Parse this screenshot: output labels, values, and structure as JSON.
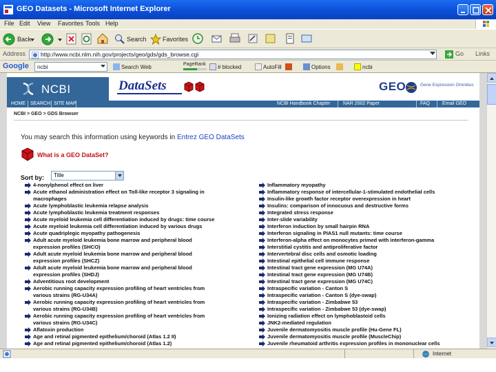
{
  "window": {
    "title": "GEO Datasets - Microsoft Internet Explorer",
    "accent": "#0a4fd8"
  },
  "menu": [
    "File",
    "Edit",
    "View",
    "Favorites",
    "Tools",
    "Help"
  ],
  "toolbar": {
    "back": "Back",
    "search": "Search",
    "favorites": "Favorites"
  },
  "address": {
    "label": "Address",
    "url": "http://www.ncbi.nlm.nih.gov/projects/geo/gds/gds_browse.cgi",
    "go": "Go",
    "links": "Links"
  },
  "google": {
    "logo": "Google",
    "query": "ncbi",
    "search_web": "Search Web",
    "pagerank": "PageRank",
    "blocked": "# blocked",
    "autofill": "AutoFill",
    "options": "Options",
    "highlight": "ncbi"
  },
  "site": {
    "ncbi": "NCBI",
    "datasets_logo": "DataSets",
    "geo": "GEO",
    "geo_tagline": "Gene Expression Omnibus",
    "nav": [
      "HOME",
      "SEARCH",
      "SITE MAP"
    ],
    "nav_right": [
      "NCBI Handbook Chapter",
      "NAR 2002 Paper",
      "FAQ",
      "Email GEO"
    ],
    "breadcrumb": "NCBI > GEO > GDS Browser",
    "intro_prefix": "You may search this information using keywords in ",
    "intro_link": "Entrez GEO DataSets",
    "what_link": "What is a GEO DataSet?",
    "sort_label": "Sort by:",
    "sort_value": "Title",
    "brand_color": "#336699"
  },
  "datasets_left": [
    [
      "4-nonylphenol effect on liver",
      ""
    ],
    [
      "Acute ethanol administration effect on Toll-like receptor 3 signaling in",
      "macrophages"
    ],
    [
      "Acute lymphoblastic leukemia relapse analysis",
      ""
    ],
    [
      "Acute lymphoblastic leukemia treatment responses",
      ""
    ],
    [
      "Acute myeloid leukemia cell differentiation induced by drugs: time course",
      ""
    ],
    [
      "Acute myeloid leukemia cell differentiation induced by various drugs",
      ""
    ],
    [
      "Acute quadriplegic myopathy pathogenesis",
      ""
    ],
    [
      "Adult acute myeloid leukemia bone marrow and peripheral blood",
      "expression profiles (SHCO)"
    ],
    [
      "Adult acute myeloid leukemia bone marrow and peripheral blood",
      "expression profiles (SHCZ)"
    ],
    [
      "Adult acute myeloid leukemia bone marrow and peripheral blood",
      "expression profiles (SHDJ)"
    ],
    [
      "Adventitious root development",
      ""
    ],
    [
      "Aerobic running capacity expression profiling of heart ventricles from",
      "various strains (RG-U34A)"
    ],
    [
      "Aerobic running capacity expression profiling of heart ventricles from",
      "various strains (RG-U34B)"
    ],
    [
      "Aerobic running capacity expression profiling of heart ventricles from",
      "various strains (RG-U34C)"
    ],
    [
      "Aflatoxin production",
      ""
    ],
    [
      "Age and retinal pigmented epithelium/choroid (Atlas 1.2 II)",
      ""
    ],
    [
      "Age and retinal pigmented epithelium/choroid (Atlas 1.2)",
      ""
    ]
  ],
  "datasets_right": [
    "Inflammatory myopathy",
    "Inflammatory response of intercellular-1-stimulated endothelial cells",
    "Insulin-like growth factor receptor overexpression in heart",
    "Insulins: comparison of innocuous and destructive forms",
    "Integrated stress response",
    "Inter-slide variability",
    "Interferon induction by small hairpin RNA",
    "Interferon signaling in PIAS1 null mutants: time course",
    "Interferon-alpha effect on monocytes primed with interferon-gamma",
    "Interstitial cystitis and antiproliferative factor",
    "Intervertebral disc cells and osmotic loading",
    "Intestinal epithelial cell immune response",
    "Intestinal tract gene expression (MG U74A)",
    "Intestinal tract gene expression (MG U74B)",
    "Intestinal tract gene expression (MG U74C)",
    "Intraspecific variation - Canton S",
    "Intraspecific variation - Canton S (dye-swap)",
    "Intraspecific variation - Zimbabwe 53",
    "Intraspecific variation - Zimbabwe 53 (dye-swap)",
    "Ionizing radiation effect on lymphoblastoid cells",
    "JNK2-mediated regulation",
    "Juvenile dermatomyositis muscle profile (Hu-Gene FL)",
    "Juvenile dermatomyositis muscle profile (MuscleChip)",
    "Juvenile rheumatoid arthritis expression profiles in mononuclear cells"
  ],
  "status": {
    "zone": "Internet"
  }
}
